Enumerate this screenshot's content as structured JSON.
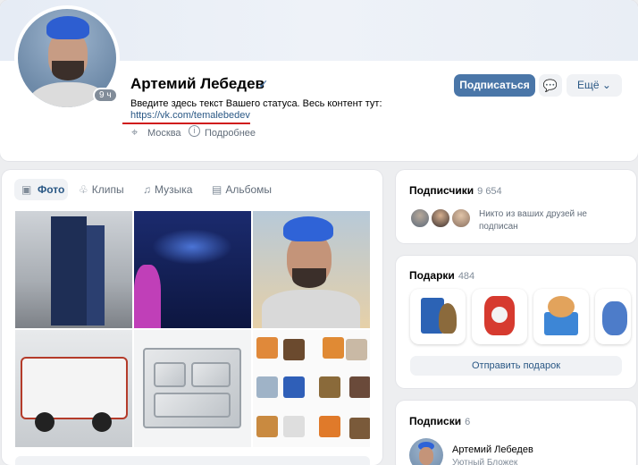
{
  "profile": {
    "name": "Артемий Лебедев",
    "verified_mark": "✓",
    "online": "9 ч",
    "status": "Введите здесь текст Вашего статуса. Весь контент тут:",
    "status_link": "https://vk.com/temalebedev",
    "city": "Москва",
    "more_info": "Подробнее",
    "subscribe_label": "Подписаться",
    "more_label": "Ещё ⌄",
    "accent_color": "#4a76a8",
    "underline_color": "#d01c1c"
  },
  "media": {
    "tabs": [
      {
        "label": "Фото",
        "icon": "photo-icon"
      },
      {
        "label": "Клипы",
        "icon": "clips-icon"
      },
      {
        "label": "Музыка",
        "icon": "music-icon"
      },
      {
        "label": "Альбомы",
        "icon": "albums-icon"
      }
    ]
  },
  "subscribers": {
    "title": "Подписчики",
    "count": "9 654",
    "note": "Никто из ваших друзей не подписан"
  },
  "gifts": {
    "title": "Подарки",
    "count": "484",
    "send_label": "Отправить подарок"
  },
  "follows": {
    "title": "Подписки",
    "count": "6",
    "item_name": "Артемий Лебедев",
    "item_desc": "Уютный Бложек"
  }
}
